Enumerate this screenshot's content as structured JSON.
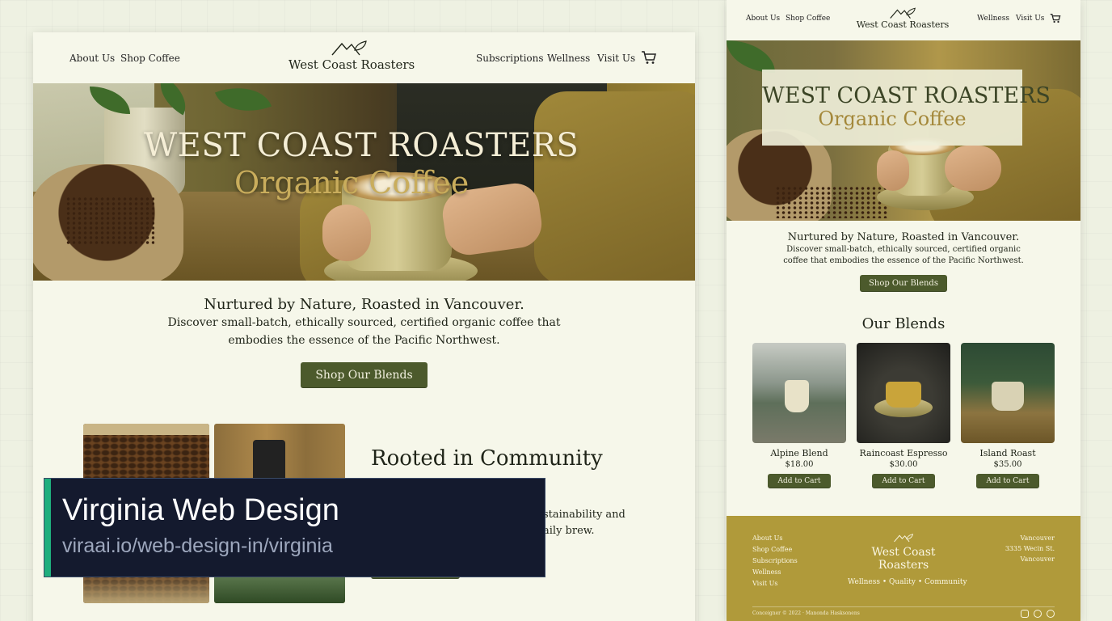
{
  "desktop": {
    "nav": {
      "about": "About Us",
      "shop": "Shop Coffee",
      "subscriptions": "Subscriptions",
      "wellness": "Wellness",
      "visit": "Visit Us",
      "logo_name": "West Coast Roasters",
      "cart_icon": "cart-icon"
    },
    "hero": {
      "title": "WEST COAST ROASTERS",
      "subtitle": "Organic Coffee"
    },
    "intro": {
      "tagline": "Nurtured by Nature, Roasted in Vancouver.",
      "description": "Discover small-batch, ethically sourced, certified organic coffee that embodies the essence of the Pacific Northwest.",
      "button": "Shop Our Blends"
    },
    "community": {
      "title": "Rooted in Community",
      "text_line1": "stainability and",
      "text_line2": "aily brew."
    }
  },
  "banner": {
    "title": "Virginia Web Design",
    "url": "viraai.io/web-design-in/virginia",
    "accent_color": "#1fae7d"
  },
  "mobile": {
    "nav": {
      "about": "About Us",
      "shop": "Shop Coffee",
      "wellness": "Wellness",
      "visit": "Visit Us",
      "logo_name": "West Coast Roasters"
    },
    "hero": {
      "title": "WEST COAST ROASTERS",
      "subtitle": "Organic Coffee"
    },
    "intro": {
      "tagline": "Nurtured by Nature, Roasted in Vancouver.",
      "description": "Discover small-batch, ethically sourced, certified organic coffee that embodies the essence of the Pacific Northwest.",
      "button": "Shop Our Blends"
    },
    "blends": {
      "title": "Our Blends",
      "products": [
        {
          "name": "Alpine Blend",
          "price": "$18.00",
          "button": "Add to Cart"
        },
        {
          "name": "Raincoast Espresso",
          "price": "$30.00",
          "button": "Add to Cart"
        },
        {
          "name": "Island Roast",
          "price": "$35.00",
          "button": "Add to Cart"
        }
      ]
    },
    "footer": {
      "links": [
        "About Us",
        "Shop Coffee",
        "Subscriptions",
        "Wellness",
        "Visit Us"
      ],
      "logo_line1": "West Coast",
      "logo_line2": "Roasters",
      "tagline": "Wellness • Quality • Community",
      "address": [
        "Vancouver",
        "3335 Wecin St.",
        "Vancouver"
      ],
      "copyright": "Conceigner © 2022 · Manonda Hasksonens",
      "social_icons": [
        "instagram-icon",
        "facebook-icon",
        "pinterest-icon"
      ]
    }
  },
  "colors": {
    "button_green": "#4c5a2c",
    "footer_gold": "#b09a3a",
    "page_bg": "#f6f7ea"
  }
}
